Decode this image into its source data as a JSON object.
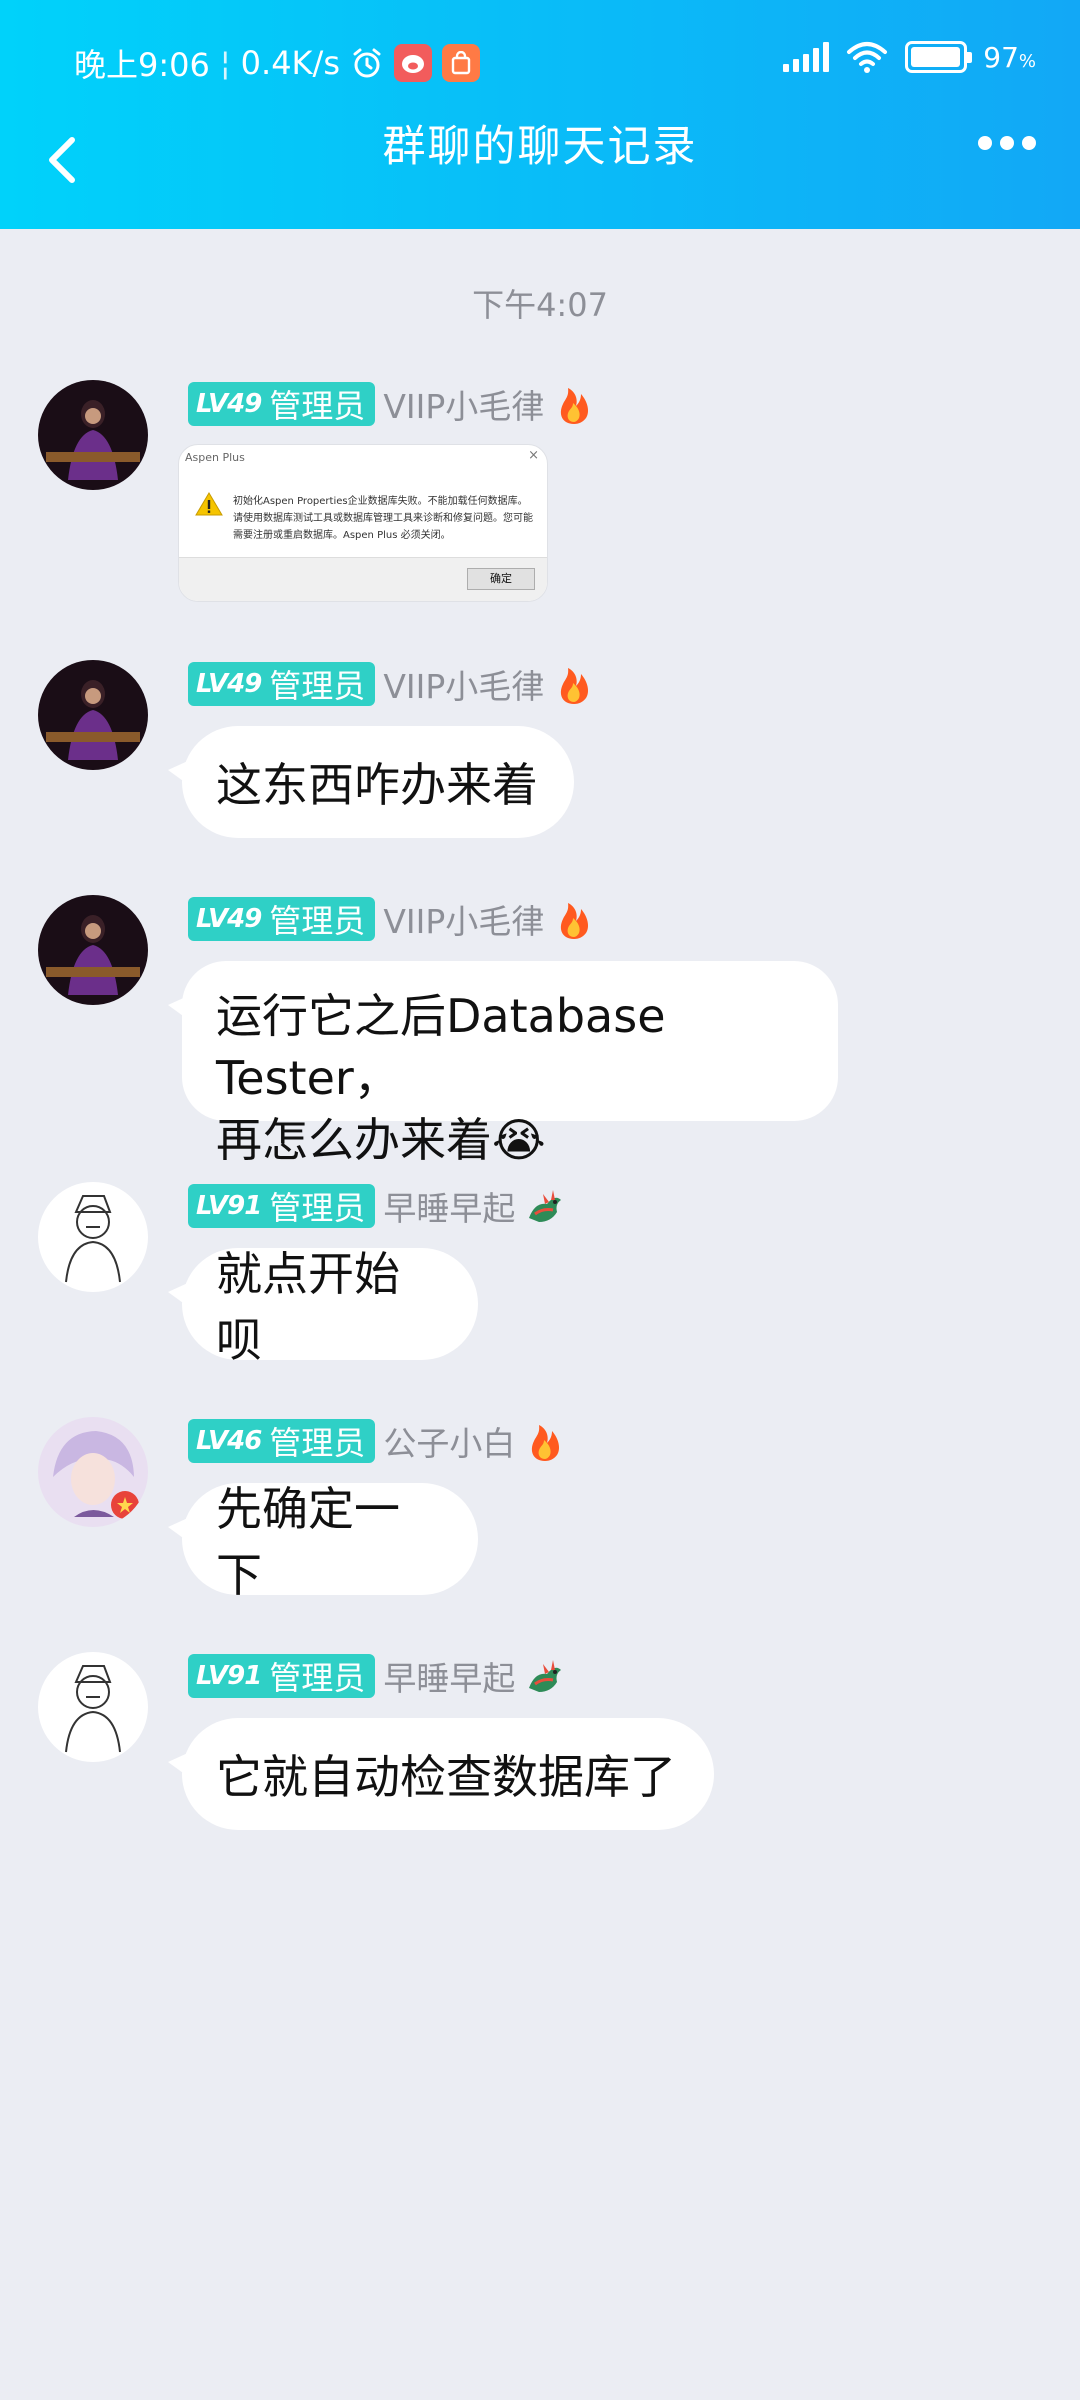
{
  "status_bar": {
    "time": "晚上9:06",
    "net_speed": "0.4K/s",
    "battery_percent": "97",
    "battery_unit": "%",
    "battery_level": 0.97
  },
  "nav": {
    "title": "群聊的聊天记录"
  },
  "chat": {
    "time_divider": "下午4:07",
    "image_message": {
      "dialog_title": "Aspen Plus",
      "dialog_close": "×",
      "dialog_text": "初始化Aspen Properties企业数据库失败。不能加载任何数据库。请使用数据库测试工具或数据库管理工具来诊断和修复问题。您可能需要注册或重启数据库。Aspen Plus 必须关闭。",
      "dialog_ok": "确定"
    },
    "messages": [
      {
        "level": "LV49",
        "role": "管理员",
        "nickname": "VIIP小毛律",
        "medal": "fire-icon"
      },
      {
        "level": "LV49",
        "role": "管理员",
        "nickname": "VIIP小毛律",
        "medal": "fire-icon",
        "text": "这东西咋办来着"
      },
      {
        "level": "LV49",
        "role": "管理员",
        "nickname": "VIIP小毛律",
        "medal": "fire-icon",
        "line1": "运行它之后Database Tester，",
        "line2": "再怎么办来着",
        "emoji": "😭"
      },
      {
        "level": "LV91",
        "role": "管理员",
        "nickname": "早睡早起",
        "medal": "dragon-icon",
        "text": "就点开始呗"
      },
      {
        "level": "LV46",
        "role": "管理员",
        "nickname": "公子小白",
        "medal": "fire-icon",
        "text": "先确定一下"
      },
      {
        "level": "LV91",
        "role": "管理员",
        "nickname": "早睡早起",
        "medal": "dragon-icon",
        "text": "它就自动检查数据库了"
      }
    ]
  }
}
